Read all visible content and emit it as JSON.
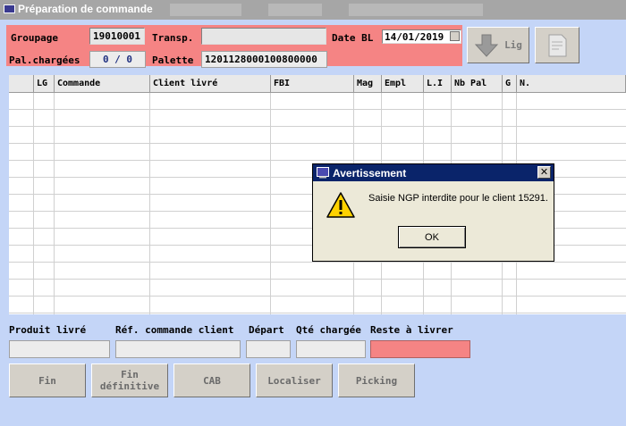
{
  "window": {
    "title": "Préparation de commande"
  },
  "header": {
    "groupage_label": "Groupage",
    "groupage_value": "19010001",
    "transp_label": "Transp.",
    "transp_value": "",
    "date_bl_label": "Date BL",
    "date_bl_value": "14/01/2019",
    "pal_chargees_label": "Pal.chargées",
    "pal_chargees_value": "0 / 0",
    "palette_label": "Palette",
    "palette_value": "1201128000100800000"
  },
  "toolbar": {
    "lig_label": "Lig"
  },
  "grid": {
    "columns": [
      "",
      "LG",
      "Commande",
      "Client livré",
      "FBI",
      "Mag",
      "Empl",
      "L.I",
      "Nb Pal",
      "G",
      "N."
    ],
    "row_count": 13
  },
  "bottom": {
    "produit_livre_label": "Produit livré",
    "ref_commande_label": "Réf. commande client",
    "depart_label": "Départ",
    "qte_chargee_label": "Qté chargée",
    "reste_label": "Reste à livrer",
    "buttons": {
      "fin": "Fin",
      "fin_definitive": "Fin définitive",
      "cab": "CAB",
      "localiser": "Localiser",
      "picking": "Picking"
    }
  },
  "dialog": {
    "title": "Avertissement",
    "message": "Saisie NGP interdite pour le client 15291.",
    "ok_label": "OK",
    "close_label": "✕"
  },
  "colors": {
    "background": "#c4d5f7",
    "header_pink": "#f58484",
    "dialog_title": "#0a246a"
  }
}
